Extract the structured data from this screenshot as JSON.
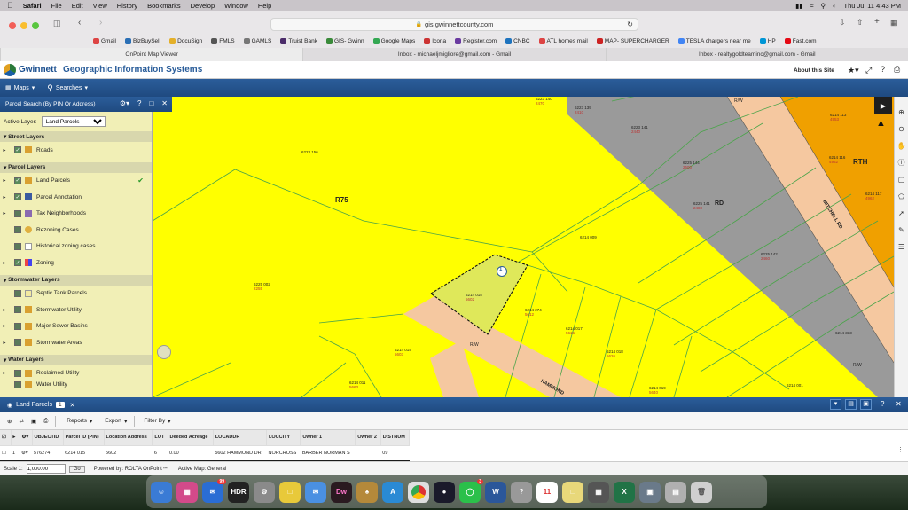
{
  "menubar": {
    "app": "Safari",
    "items": [
      "File",
      "Edit",
      "View",
      "History",
      "Bookmarks",
      "Develop",
      "Window",
      "Help"
    ],
    "datetime": "Thu Jul 11  4:43 PM"
  },
  "browser": {
    "url": "gis.gwinnettcounty.com",
    "bookmarks": [
      "Gmail",
      "BizBuySell",
      "DocuSign",
      "FMLS",
      "GAMLS",
      "Truist Bank",
      "GIS- Gwinn",
      "Google Maps",
      "Icona",
      "Register.com",
      "CNBC",
      "ATL homes mail",
      "MAP- SUPERCHARGER",
      "TESLA chargers near me",
      "HP",
      "Fast.com"
    ],
    "tabs": [
      {
        "label": "OnPoint Map Viewer",
        "active": true
      },
      {
        "label": "Inbox - michaeljmigliore@gmail.com - Gmail",
        "active": false
      },
      {
        "label": "Inbox - realtygoldteaminc@gmail.com - Gmail",
        "active": false
      }
    ]
  },
  "app": {
    "brand": "Gwinnett",
    "title": "Geographic Information Systems",
    "about": "About this Site"
  },
  "toolbar": {
    "maps": "Maps",
    "searches": "Searches"
  },
  "panel": {
    "title": "Parcel Search (By PIN Or Address)",
    "active_layer_label": "Active Layer:",
    "active_layer_value": "Land Parcels",
    "groups": [
      {
        "name": "Street Layers",
        "items": [
          {
            "label": "Roads",
            "checked": true
          }
        ]
      },
      {
        "name": "Parcel Layers",
        "items": [
          {
            "label": "Land Parcels",
            "checked": true,
            "active": true
          },
          {
            "label": "Parcel Annotation",
            "checked": true
          },
          {
            "label": "Tax Neighborhoods",
            "checked": false
          },
          {
            "label": "Rezoning Cases",
            "checked": false
          },
          {
            "label": "Historical zoning cases",
            "checked": false
          },
          {
            "label": "Zoning",
            "checked": true
          }
        ]
      },
      {
        "name": "Stormwater Layers",
        "items": [
          {
            "label": "Septic Tank Parcels",
            "checked": false
          },
          {
            "label": "Stormwater Utility",
            "checked": false
          },
          {
            "label": "Major Sewer Basins",
            "checked": false
          },
          {
            "label": "Stormwater Areas",
            "checked": false
          }
        ]
      },
      {
        "name": "Water Layers",
        "items": [
          {
            "label": "Reclaimed Utility",
            "checked": false
          },
          {
            "label": "Water Utility",
            "checked": false
          }
        ]
      }
    ]
  },
  "map": {
    "zoning": [
      "R75",
      "RTH",
      "RD"
    ],
    "road_labels": [
      "R/W",
      "R/W",
      "R/W",
      "MITCHELL RD",
      "HAMMOND"
    ],
    "selected_marker": "1",
    "parcels": [
      {
        "pin": "6223 140",
        "addr": "2470"
      },
      {
        "pin": "6223 139",
        "addr": "2410"
      },
      {
        "pin": "6223 141",
        "addr": "2440"
      },
      {
        "pin": "6223 156",
        "addr": ""
      },
      {
        "pin": "6225 144",
        "addr": "2500"
      },
      {
        "pin": "6225 141",
        "addr": "2480"
      },
      {
        "pin": "6214 009",
        "addr": ""
      },
      {
        "pin": "6225 142",
        "addr": "2460"
      },
      {
        "pin": "6214 015",
        "addr": "5602"
      },
      {
        "pin": "6214 274",
        "addr": "5612"
      },
      {
        "pin": "6214 017",
        "addr": "5616"
      },
      {
        "pin": "6214 018",
        "addr": "5626"
      },
      {
        "pin": "6225 002",
        "addr": "2255"
      },
      {
        "pin": "6214 014",
        "addr": "5603"
      },
      {
        "pin": "6214 011",
        "addr": "5663"
      },
      {
        "pin": "6214 019",
        "addr": "5640"
      },
      {
        "pin": "6214 001",
        "addr": ""
      },
      {
        "pin": "6214 113",
        "addr": "4953"
      },
      {
        "pin": "6214 116",
        "addr": "4962"
      },
      {
        "pin": "6214 117",
        "addr": "4962"
      },
      {
        "pin": "6214 333",
        "addr": ""
      }
    ]
  },
  "results": {
    "tab_label": "Land Parcels",
    "count": "1",
    "buttons": {
      "reports": "Reports",
      "export": "Export",
      "filter": "Filter By"
    },
    "columns": [
      "OBJECTID",
      "Parcel ID (PIN)",
      "Location Address",
      "LOT",
      "Deeded Acreage",
      "LOCADDR",
      "LOCCITY",
      "Owner 1",
      "Owner 2",
      "DISTNUM"
    ],
    "rows": [
      {
        "index": "1",
        "objectid": "576274",
        "pin": "6214 015",
        "location_address": "5602",
        "lot": "6",
        "deeded_acreage": "0.00",
        "locaddr": "5602 HAMMOND DR",
        "loccity": "NORCROSS",
        "owner1": "BARBER NORMAN S",
        "owner2": "",
        "distnum": "09"
      }
    ]
  },
  "status": {
    "scale_label": "Scale 1:",
    "scale_value": "1,000.00",
    "go": "Go",
    "powered_by": "Powered by: ROLTA OnPoint™",
    "active_map": "Active Map: General"
  },
  "dock": {
    "mail_badge": "99",
    "messages_badge": "3",
    "calendar_day": "11"
  },
  "colors": {
    "zoning_yellow": "#ffff00",
    "commercial_orange": "#f0a000",
    "road_peach": "#f5c8a0",
    "gray_zone": "#9a9a9a",
    "header_blue": "#1f4a80"
  }
}
